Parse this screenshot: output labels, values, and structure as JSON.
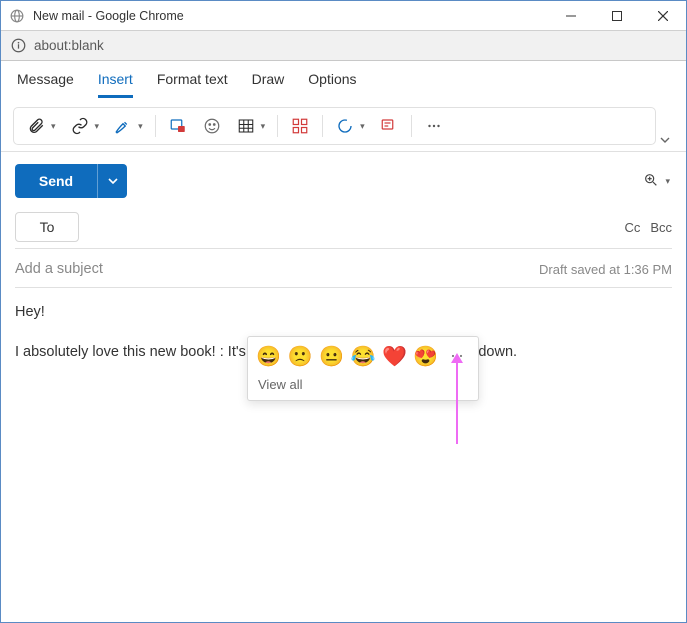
{
  "window": {
    "title": "New mail - Google Chrome",
    "url": "about:blank"
  },
  "tabs": {
    "message": "Message",
    "insert": "Insert",
    "format": "Format text",
    "draw": "Draw",
    "options": "Options"
  },
  "compose": {
    "send_label": "Send",
    "to_label": "To",
    "cc_label": "Cc",
    "bcc_label": "Bcc",
    "subject_placeholder": "Add a subject",
    "draft_status": "Draft saved at 1:36 PM",
    "body_line1": "Hey!",
    "body_line2": "I absolutely love this new book! : It's a captivating read, and I can't put it down."
  },
  "emoji": {
    "items": [
      "😄",
      "🙁",
      "😐",
      "😂",
      "❤️",
      "😍"
    ],
    "view_all": "View all"
  }
}
